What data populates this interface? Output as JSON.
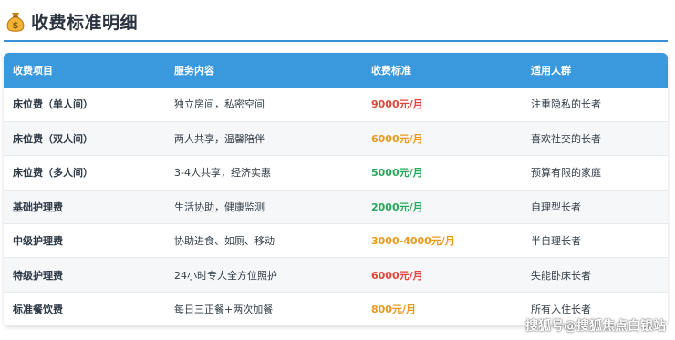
{
  "header": {
    "title": "收费标准明细",
    "icon": "money-bag-icon"
  },
  "table": {
    "columns": [
      "收费项目",
      "服务内容",
      "收费标准",
      "适用人群"
    ],
    "rows": [
      {
        "item": "床位费（单人间）",
        "service": "独立房间，私密空间",
        "price": "9000元/月",
        "price_color": "#e0463a",
        "audience": "注重隐私的长者"
      },
      {
        "item": "床位费（双人间）",
        "service": "两人共享，温馨陪伴",
        "price": "6000元/月",
        "price_color": "#e89a1c",
        "audience": "喜欢社交的长者"
      },
      {
        "item": "床位费（多人间）",
        "service": "3-4人共享，经济实惠",
        "price": "5000元/月",
        "price_color": "#2aa85a",
        "audience": "预算有限的家庭"
      },
      {
        "item": "基础护理费",
        "service": "生活协助，健康监测",
        "price": "2000元/月",
        "price_color": "#2aa85a",
        "audience": "自理型长者"
      },
      {
        "item": "中级护理费",
        "service": "协助进食、如厕、移动",
        "price": "3000-4000元/月",
        "price_color": "#e89a1c",
        "audience": "半自理长者"
      },
      {
        "item": "特级护理费",
        "service": "24小时专人全方位照护",
        "price": "6000元/月",
        "price_color": "#e0463a",
        "audience": "失能卧床长者"
      },
      {
        "item": "标准餐饮费",
        "service": "每日三正餐+两次加餐",
        "price": "800元/月",
        "price_color": "#e89a1c",
        "audience": "所有入住长者"
      }
    ]
  },
  "colors": {
    "header_bg": "#3a98dc",
    "accent_line": "#3a8fd6"
  },
  "watermark": "搜狐号@搜狐焦点白银站"
}
